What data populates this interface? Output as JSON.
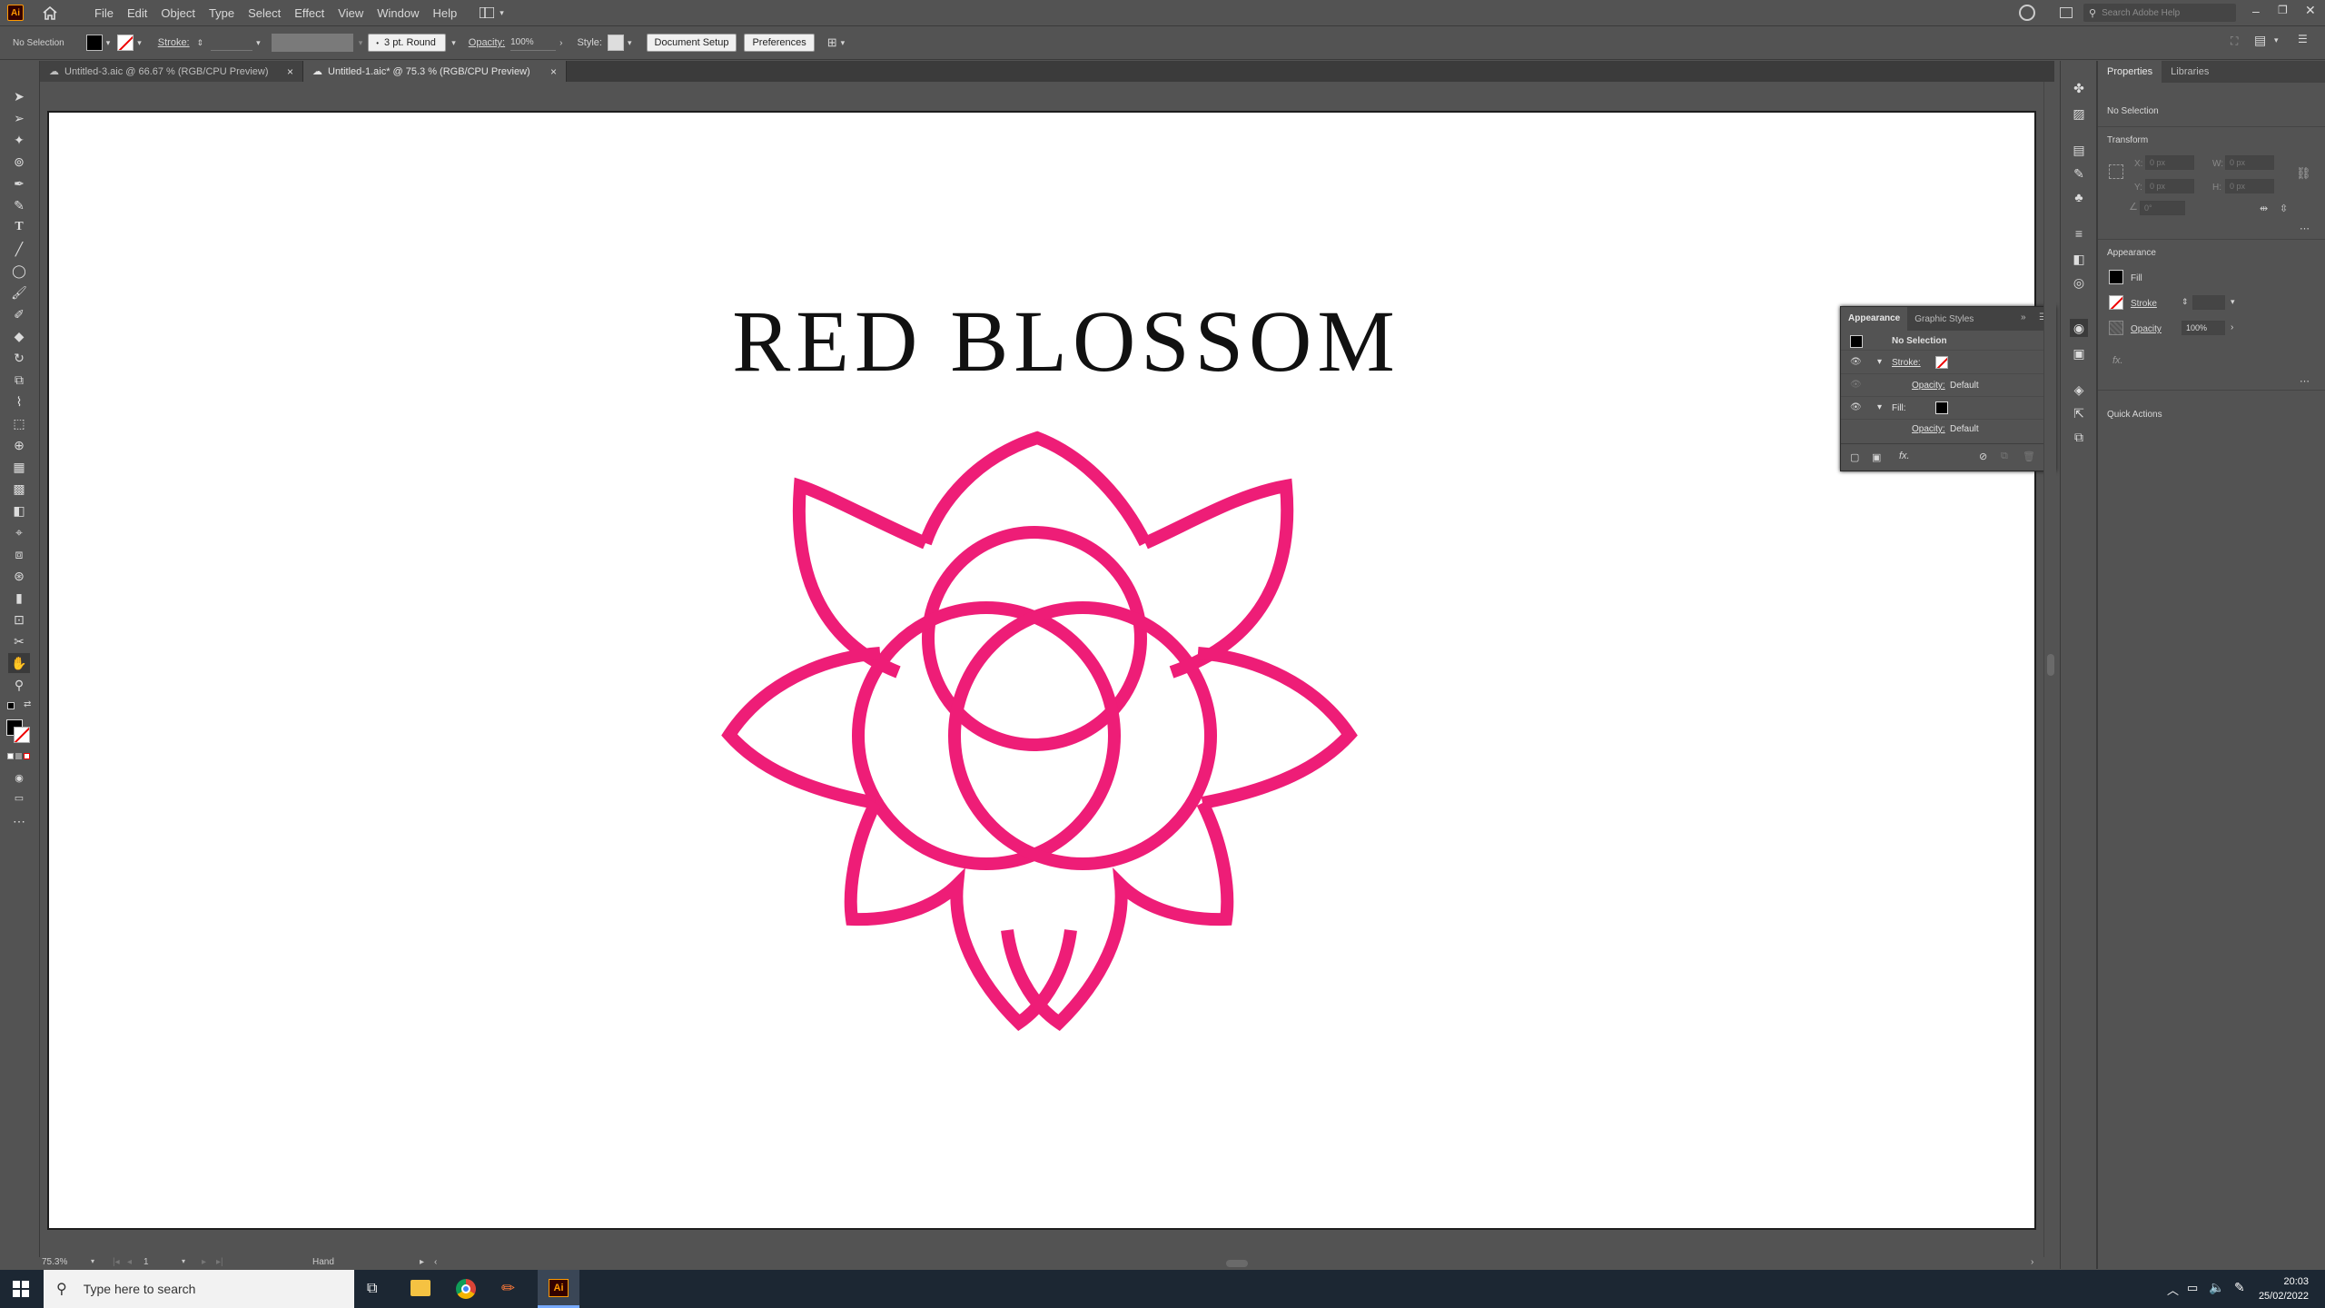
{
  "app": {
    "logo": "Ai"
  },
  "menu": [
    "File",
    "Edit",
    "Object",
    "Type",
    "Select",
    "Effect",
    "View",
    "Window",
    "Help"
  ],
  "search": {
    "placeholder": "Search Adobe Help"
  },
  "control": {
    "selection": "No Selection",
    "stroke_label": "Stroke:",
    "brush": "3 pt. Round",
    "opacity_label": "Opacity:",
    "opacity_value": "100%",
    "style_label": "Style:",
    "doc_setup": "Document Setup",
    "preferences": "Preferences"
  },
  "tabs": [
    {
      "label": "Untitled-3.aic @ 66.67 % (RGB/CPU Preview)",
      "close": "×"
    },
    {
      "label": "Untitled-1.aic* @ 75.3 % (RGB/CPU Preview)",
      "close": "×"
    }
  ],
  "artwork": {
    "title": "RED BLOSSOM",
    "color": "#ee1d77"
  },
  "appearance_panel": {
    "tab_active": "Appearance",
    "tab_other": "Graphic Styles",
    "header": "No Selection",
    "stroke_label": "Stroke:",
    "opacity_row": "Opacity:",
    "opacity_val": "Default",
    "fill_label": "Fill:",
    "opacity_row2": "Opacity:",
    "opacity_val2": "Default"
  },
  "properties": {
    "tab_active": "Properties",
    "tab_other": "Libraries",
    "selection": "No Selection",
    "transform_title": "Transform",
    "x_label": "X:",
    "x_value": "0 px",
    "y_label": "Y:",
    "y_value": "0 px",
    "w_label": "W:",
    "w_value": "0 px",
    "h_label": "H:",
    "h_value": "0 px",
    "angle_value": "0°",
    "appearance_title": "Appearance",
    "fill_label": "Fill",
    "stroke_label": "Stroke",
    "opacity_label": "Opacity",
    "opacity_value": "100%",
    "quick_actions": "Quick Actions"
  },
  "status": {
    "zoom": "75.3%",
    "artboard": "1",
    "tool": "Hand"
  },
  "taskbar": {
    "search_placeholder": "Type here to search",
    "time": "20:03",
    "date": "25/02/2022"
  },
  "colors": {
    "ui_bg": "#535353",
    "artwork": "#ee1d77",
    "taskbar": "#1c2733"
  }
}
